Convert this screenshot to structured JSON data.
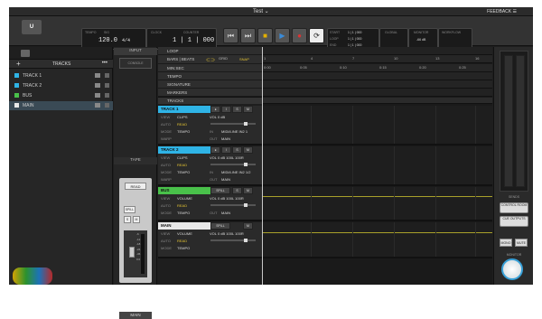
{
  "window": {
    "title": "Test ⌄",
    "feedback": "FEEDBACK ☰"
  },
  "transport": {
    "tempo_label": "TEMPO",
    "tempo": "120.0",
    "sig_label": "SIG",
    "sig": "4/4",
    "clock_label": "CLOCK",
    "clock": "",
    "counter_label": "COUNTER",
    "counter": "1 | 1 | 000",
    "buttons": [
      "⏮",
      "⏭",
      "■",
      "▶",
      "●",
      "⟳"
    ],
    "markers": [
      "START",
      "LOOP",
      "END"
    ],
    "loop_values": [
      "1 | 1 | 000",
      "1 | 1 | 000",
      "1 | 1 | 000"
    ],
    "global_label": "GLOBAL",
    "monitor_label": "MONITOR",
    "workflow_label": "WORKFLOW",
    "monitor_db": "-66 dB"
  },
  "sidebar": {
    "header": "TRACKS",
    "items": [
      {
        "label": "TRACK 1",
        "color": "#2fb4e6"
      },
      {
        "label": "TRACK 2",
        "color": "#2fb4e6"
      },
      {
        "label": "BUS",
        "color": "#49c14a"
      },
      {
        "label": "MAIN",
        "color": "#e8e8e8"
      }
    ]
  },
  "inputs": {
    "input_label": "INPUT",
    "console_label": "CONSOLE",
    "tape_label": "TAPE",
    "read": "READ",
    "spill": "SPILL",
    "solo": "S",
    "mute": "M",
    "scale": [
      "-6",
      "-12",
      "-18",
      "-24",
      "-36",
      "0.0"
    ],
    "strip_name": "MAIN"
  },
  "props": {
    "rows": [
      "LOOP",
      "BARS | BEATS",
      "MIN:SEC",
      "TEMPO",
      "SIGNATURE",
      "MARKERS"
    ],
    "grid_label": "GRID",
    "snap_label": "SNAP",
    "tempo_value": "120.00",
    "sig_value": "4/4"
  },
  "tracks_header": "TRACKS",
  "tracks": [
    {
      "name": "TRACK 1",
      "color": "#2fb4e6",
      "view": "CLIPS",
      "auto": "READ",
      "mode": "TEMPO",
      "warp": "",
      "vol": "VOL  0 dB",
      "pan": "PAN  C",
      "in": "MIDI/LINE IN2 1",
      "out": "MAIN"
    },
    {
      "name": "TRACK 2",
      "color": "#2fb4e6",
      "view": "CLIPS",
      "auto": "READ",
      "mode": "TEMPO",
      "warp": "",
      "vol": "VOL  0 dB  100L  100R",
      "pan": "",
      "in": "MIDI/LINE IN2 1/2",
      "out": "MAIN"
    },
    {
      "name": "BUS",
      "color": "#49c14a",
      "view": "VOLUME",
      "auto": "READ",
      "mode": "TEMPO",
      "vol": "VOL  0 dB  100L  100R",
      "out": "MAIN"
    },
    {
      "name": "MAIN",
      "color": "#e8e8e8",
      "view": "VOLUME",
      "auto": "READ",
      "mode": "TEMPO",
      "vol": "VOL  0 dB  100L  100R"
    }
  ],
  "field_labels": {
    "view": "VIEW",
    "auto": "AUTO",
    "mode": "MODE",
    "warp": "WARP",
    "in": "IN",
    "out": "OUT",
    "spill": "SPILL"
  },
  "ruler": {
    "bars": [
      "1",
      "4",
      "7",
      "10",
      "13",
      "16"
    ],
    "times": [
      "0:00",
      "0:05",
      "0:10",
      "0:15",
      "0:20",
      "0:25"
    ]
  },
  "right_panel": {
    "sends_label": "SENDS",
    "control_room": "CONTROL ROOM",
    "cue_outputs": "CUE OUTPUTS",
    "mono": "MONO",
    "mute": "MUTE",
    "monitor_label": "MONITOR"
  }
}
